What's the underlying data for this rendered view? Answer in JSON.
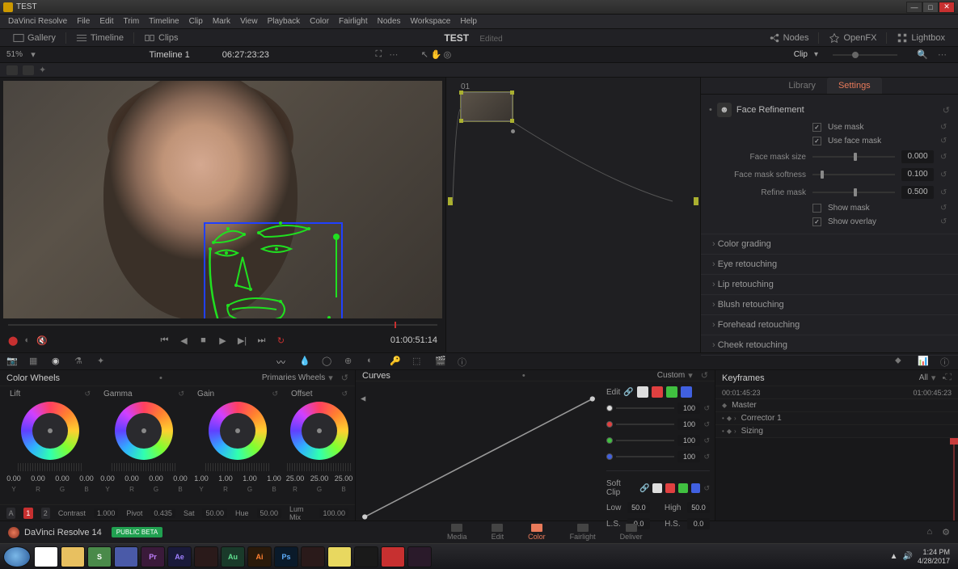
{
  "window": {
    "title": "TEST"
  },
  "menu": [
    "DaVinci Resolve",
    "File",
    "Edit",
    "Trim",
    "Timeline",
    "Clip",
    "Mark",
    "View",
    "Playback",
    "Color",
    "Fairlight",
    "Nodes",
    "Workspace",
    "Help"
  ],
  "topbar": {
    "gallery": "Gallery",
    "timeline": "Timeline",
    "clips": "Clips",
    "project": "TEST",
    "status": "Edited",
    "nodes": "Nodes",
    "openfx": "OpenFX",
    "lightbox": "Lightbox"
  },
  "secondbar": {
    "zoom": "51%",
    "timeline": "Timeline 1",
    "tc_left": "06:27:23:23",
    "clip": "Clip"
  },
  "viewer": {
    "tc": "01:00:51:14"
  },
  "nodes": {
    "clip": "01"
  },
  "inspector": {
    "tabs": {
      "library": "Library",
      "settings": "Settings"
    },
    "section": "Face Refinement",
    "use_mask": "Use mask",
    "use_face_mask": "Use face mask",
    "face_mask_size": {
      "label": "Face mask size",
      "value": "0.000",
      "pos": 50
    },
    "face_mask_softness": {
      "label": "Face mask softness",
      "value": "0.100",
      "pos": 10
    },
    "refine_mask": {
      "label": "Refine mask",
      "value": "0.500",
      "pos": 50
    },
    "show_mask": "Show mask",
    "show_overlay": "Show overlay",
    "collapsed": [
      "Color grading",
      "Eye retouching",
      "Lip retouching",
      "Blush retouching",
      "Forehead retouching",
      "Cheek retouching"
    ]
  },
  "wheels": {
    "title": "Color Wheels",
    "mode": "Primaries Wheels",
    "items": [
      {
        "name": "Lift",
        "vals": [
          "0.00",
          "0.00",
          "0.00",
          "0.00"
        ]
      },
      {
        "name": "Gamma",
        "vals": [
          "0.00",
          "0.00",
          "0.00",
          "0.00"
        ]
      },
      {
        "name": "Gain",
        "vals": [
          "1.00",
          "1.00",
          "1.00",
          "1.00"
        ]
      },
      {
        "name": "Offset",
        "vals": [
          "25.00",
          "25.00",
          "25.00"
        ]
      }
    ],
    "labels4": [
      "Y",
      "R",
      "G",
      "B"
    ],
    "labels3": [
      "R",
      "G",
      "B"
    ],
    "footer": {
      "a": "A",
      "one": "1",
      "two": "2",
      "contrast": "Contrast",
      "contrast_v": "1.000",
      "pivot": "Pivot",
      "pivot_v": "0.435",
      "sat": "Sat",
      "sat_v": "50.00",
      "hue": "Hue",
      "hue_v": "50.00",
      "lummix": "Lum Mix",
      "lummix_v": "100.00"
    }
  },
  "curves": {
    "title": "Curves",
    "mode": "Custom",
    "edit": "Edit",
    "channels": [
      {
        "c": "y",
        "v": "100"
      },
      {
        "c": "r",
        "v": "100"
      },
      {
        "c": "g",
        "v": "100"
      },
      {
        "c": "b",
        "v": "100"
      }
    ],
    "softclip": "Soft Clip",
    "low": {
      "label": "Low",
      "v": "50.0"
    },
    "high": {
      "label": "High",
      "v": "50.0"
    },
    "ls": {
      "label": "L.S.",
      "v": "0.0"
    },
    "hs": {
      "label": "H.S.",
      "v": "0.0"
    }
  },
  "keyframes": {
    "title": "Keyframes",
    "all": "All",
    "tc1": "00:01:45:23",
    "tc2": "01:00:45:23",
    "tracks": [
      {
        "name": "Master"
      },
      {
        "name": "Corrector 1"
      },
      {
        "name": "Sizing"
      }
    ]
  },
  "pagebar": {
    "brand": "DaVinci Resolve 14",
    "badge": "PUBLIC BETA",
    "pages": [
      {
        "n": "Media"
      },
      {
        "n": "Edit"
      },
      {
        "n": "Color",
        "active": true
      },
      {
        "n": "Fairlight"
      },
      {
        "n": "Deliver"
      }
    ]
  },
  "taskbar": {
    "apps": [
      {
        "bg": "#fff",
        "fg": "#e04040",
        "t": ""
      },
      {
        "bg": "#e8c060",
        "fg": "#333",
        "t": ""
      },
      {
        "bg": "#4a8a4a",
        "fg": "#fff",
        "t": "S"
      },
      {
        "bg": "#4a5aa8",
        "fg": "#fff",
        "t": ""
      },
      {
        "bg": "#3a1a3a",
        "fg": "#c080ff",
        "t": "Pr"
      },
      {
        "bg": "#1a1a3a",
        "fg": "#a080ff",
        "t": "Ae"
      },
      {
        "bg": "#2a1a1a",
        "fg": "#ff9060",
        "t": ""
      },
      {
        "bg": "#1a3a2a",
        "fg": "#60e090",
        "t": "Au"
      },
      {
        "bg": "#2a1a0a",
        "fg": "#ff8030",
        "t": "Ai"
      },
      {
        "bg": "#0a1a2a",
        "fg": "#60b0ff",
        "t": "Ps"
      },
      {
        "bg": "#2a1a1a",
        "fg": "#e87a5a",
        "t": ""
      },
      {
        "bg": "#e8d860",
        "fg": "#333",
        "t": ""
      },
      {
        "bg": "#1a1a1a",
        "fg": "#20d060",
        "t": ""
      },
      {
        "bg": "#c73030",
        "fg": "#fff",
        "t": ""
      },
      {
        "bg": "#2a1a2a",
        "fg": "#e060a0",
        "t": ""
      }
    ],
    "time": "1:24 PM",
    "date": "4/28/2017"
  }
}
